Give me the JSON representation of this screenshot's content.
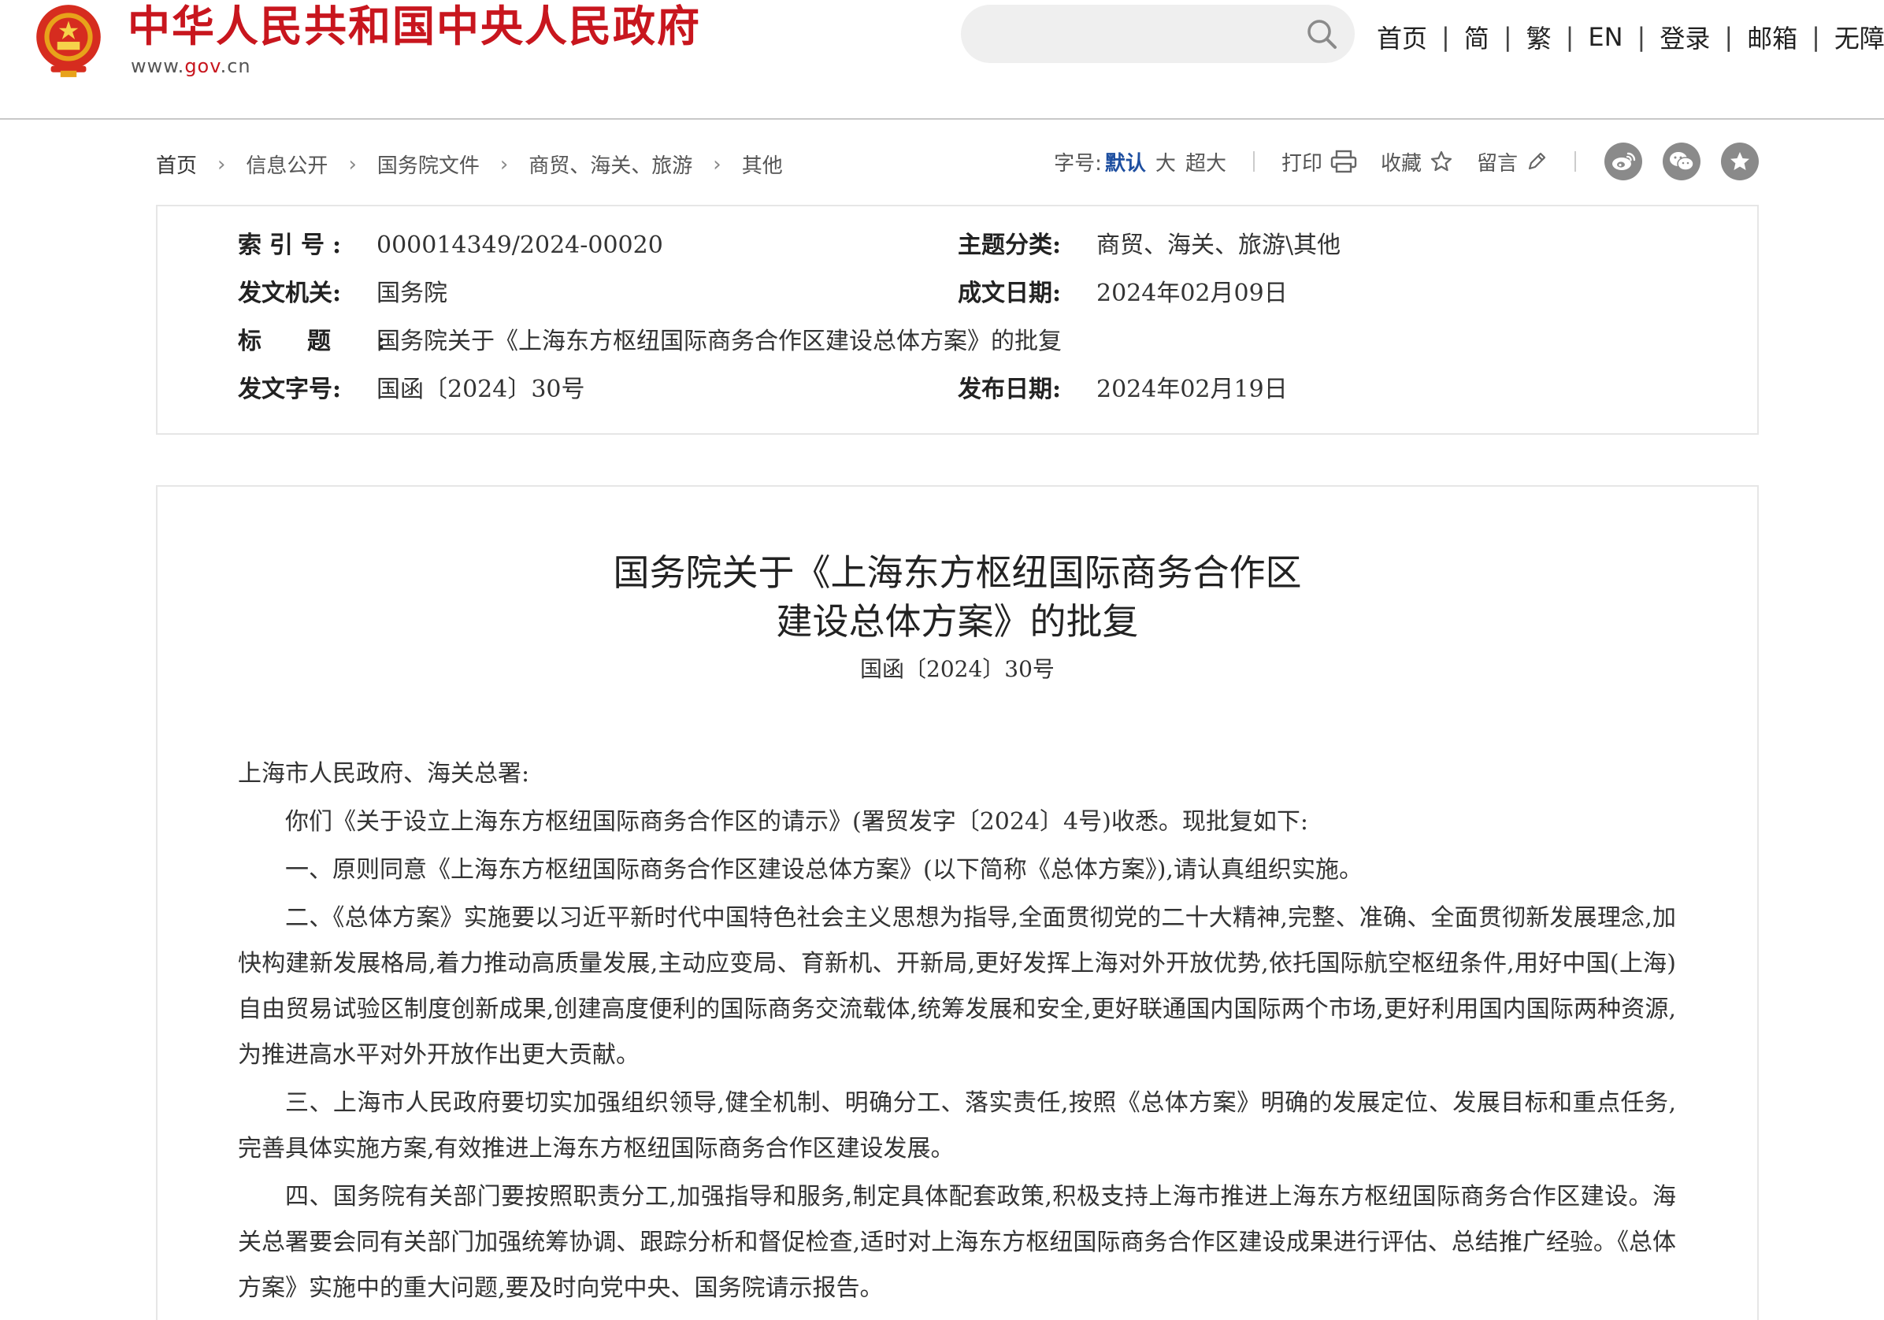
{
  "header": {
    "site_title": "中华人民共和国中央人民政府",
    "domain_prefix": "www.",
    "domain_red": "gov",
    "domain_suffix": ".cn",
    "search_placeholder": "",
    "nav": [
      "首页",
      "简",
      "繁",
      "EN",
      "登录",
      "邮箱",
      "无障碍"
    ]
  },
  "breadcrumb": [
    "首页",
    "信息公开",
    "国务院文件",
    "商贸、海关、旅游",
    "其他"
  ],
  "tools": {
    "font_label": "字号:",
    "font_options": [
      "默认",
      "大",
      "超大"
    ],
    "print": "打印",
    "favorite": "收藏",
    "comment": "留言"
  },
  "meta": {
    "index_no_key": "索引号:",
    "index_no": "000014349/2024-00020",
    "topic_key": "主题分类:",
    "topic": "商贸、海关、旅游\\其他",
    "issuer_key": "发文机关:",
    "issuer": "国务院",
    "written_key": "成文日期:",
    "written": "2024年02月09日",
    "title_key": "标题:",
    "title": "国务院关于《上海东方枢纽国际商务合作区建设总体方案》的批复",
    "doc_no_key": "发文字号:",
    "doc_no": "国函〔2024〕30号",
    "published_key": "发布日期:",
    "published": "2024年02月19日"
  },
  "article": {
    "title_line1": "国务院关于《上海东方枢纽国际商务合作区",
    "title_line2": "建设总体方案》的批复",
    "doc_no": "国函〔2024〕30号",
    "salutation": "上海市人民政府、海关总署:",
    "paragraphs": [
      "你们《关于设立上海东方枢纽国际商务合作区的请示》(署贸发字〔2024〕4号)收悉。现批复如下:",
      "一、原则同意《上海东方枢纽国际商务合作区建设总体方案》(以下简称《总体方案》),请认真组织实施。",
      "二、《总体方案》实施要以习近平新时代中国特色社会主义思想为指导,全面贯彻党的二十大精神,完整、准确、全面贯彻新发展理念,加快构建新发展格局,着力推动高质量发展,主动应变局、育新机、开新局,更好发挥上海对外开放优势,依托国际航空枢纽条件,用好中国(上海)自由贸易试验区制度创新成果,创建高度便利的国际商务交流载体,统筹发展和安全,更好联通国内国际两个市场,更好利用国内国际两种资源,为推进高水平对外开放作出更大贡献。",
      "三、上海市人民政府要切实加强组织领导,健全机制、明确分工、落实责任,按照《总体方案》明确的发展定位、发展目标和重点任务,完善具体实施方案,有效推进上海东方枢纽国际商务合作区建设发展。",
      "四、国务院有关部门要按照职责分工,加强指导和服务,制定具体配套政策,积极支持上海市推进上海东方枢纽国际商务合作区建设。海关总署要会同有关部门加强统筹协调、跟踪分析和督促检查,适时对上海东方枢纽国际商务合作区建设成果进行评估、总结推广经验。《总体方案》实施中的重大问题,要及时向党中央、国务院请示报告。"
    ]
  },
  "colors": {
    "brand_red": "#c8161e",
    "link_blue": "#1e4fa0",
    "icon_gray": "#8a8a8a"
  }
}
